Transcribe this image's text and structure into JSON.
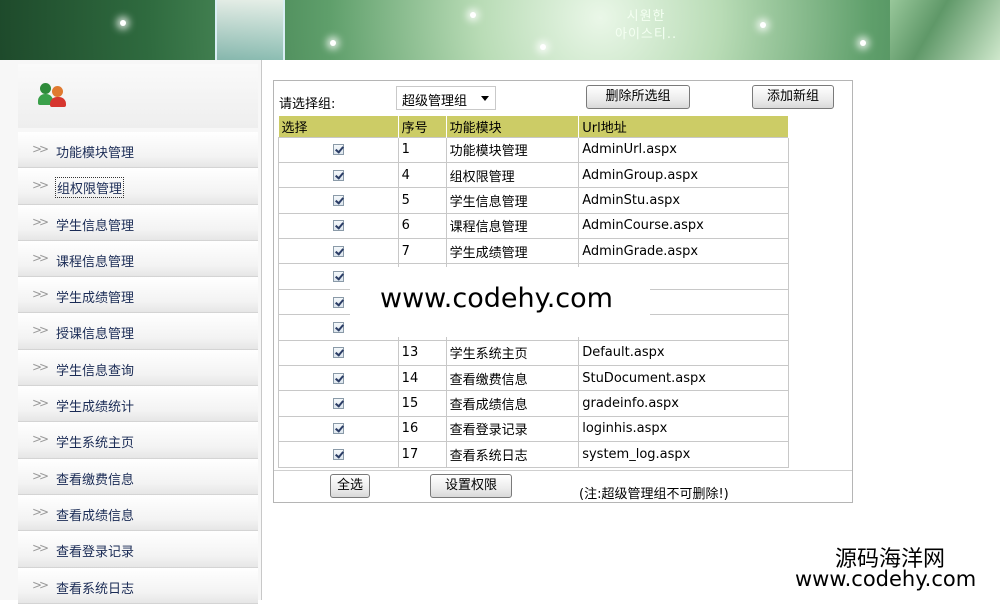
{
  "banner": {
    "korean_line1": "시원한",
    "korean_line2": "아이스티.."
  },
  "sidebar": {
    "items": [
      {
        "label": "功能模块管理"
      },
      {
        "label": "组权限管理",
        "active": true
      },
      {
        "label": "学生信息管理"
      },
      {
        "label": "课程信息管理"
      },
      {
        "label": "学生成绩管理"
      },
      {
        "label": "授课信息管理"
      },
      {
        "label": "学生信息查询"
      },
      {
        "label": "学生成绩统计"
      },
      {
        "label": "学生系统主页"
      },
      {
        "label": "查看缴费信息"
      },
      {
        "label": "查看成绩信息"
      },
      {
        "label": "查看登录记录"
      },
      {
        "label": "查看系统日志"
      }
    ]
  },
  "toolbar": {
    "group_label": "请选择组:",
    "group_value": "超级管理组",
    "delete_label": "删除所选组",
    "add_label": "添加新组"
  },
  "table": {
    "headers": [
      "选择",
      "序号",
      "功能模块",
      "Url地址"
    ],
    "rows": [
      {
        "no": "1",
        "module": "功能模块管理",
        "url": "AdminUrl.aspx"
      },
      {
        "no": "4",
        "module": "组权限管理",
        "url": "AdminGroup.aspx"
      },
      {
        "no": "5",
        "module": "学生信息管理",
        "url": "AdminStu.aspx"
      },
      {
        "no": "6",
        "module": "课程信息管理",
        "url": "AdminCourse.aspx"
      },
      {
        "no": "7",
        "module": "学生成绩管理",
        "url": "AdminGrade.aspx"
      },
      {
        "no": "",
        "module": "",
        "url": "her.aspx"
      },
      {
        "no": "",
        "module": "",
        "url": "arch.aspx"
      },
      {
        "no": "",
        "module": "",
        "url": "at.aspx"
      },
      {
        "no": "13",
        "module": "学生系统主页",
        "url": "Default.aspx"
      },
      {
        "no": "14",
        "module": "查看缴费信息",
        "url": "StuDocument.aspx"
      },
      {
        "no": "15",
        "module": "查看成绩信息",
        "url": "gradeinfo.aspx"
      },
      {
        "no": "16",
        "module": "查看登录记录",
        "url": "loginhis.aspx"
      },
      {
        "no": "17",
        "module": "查看系统日志",
        "url": "system_log.aspx"
      }
    ]
  },
  "footer": {
    "select_all_label": "全选",
    "set_perm_label": "设置权限",
    "note": "(注:超级管理组不可删除!)"
  },
  "watermark": {
    "center_text": "www.codehy.com",
    "corner_cn": "源码海洋网",
    "corner_url": "www.codehy.com"
  }
}
